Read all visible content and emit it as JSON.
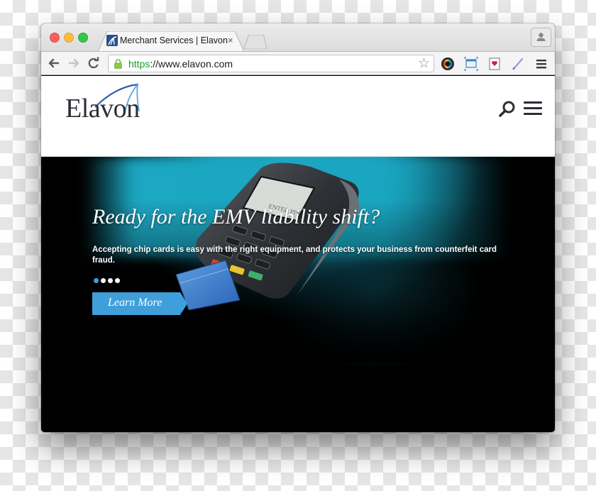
{
  "browser": {
    "tab": {
      "title": "Merchant Services | Elavon",
      "close_glyph": "×",
      "favicon": "elavon-favicon"
    },
    "address_bar": {
      "scheme": "https",
      "rest": "://www.elavon.com",
      "secure": true
    },
    "nav": {
      "back": "←",
      "forward": "→",
      "reload": "C"
    },
    "bookmark_glyph": "☆",
    "extensions": [
      "color-picker-icon",
      "screenshot-icon",
      "pocket-icon",
      "pen-icon"
    ],
    "menu": "hamburger-menu-icon",
    "profile": "profile-icon"
  },
  "site": {
    "logo_text": "Elavon",
    "header_icons": [
      "search-icon",
      "menu-icon"
    ]
  },
  "hero": {
    "title": "Ready for the EMV liability shift?",
    "subtitle": "Accepting chip cards is easy with the right equipment, and protects your business from counterfeit card fraud.",
    "carousel": {
      "slide_count": 4,
      "active_index": 0
    },
    "cta_label": "Learn More",
    "terminal_screen_text": "ENTER PIN",
    "colors": {
      "accent": "#3f9fdb",
      "teal": "#1ca7c2",
      "background": "#000000"
    }
  }
}
